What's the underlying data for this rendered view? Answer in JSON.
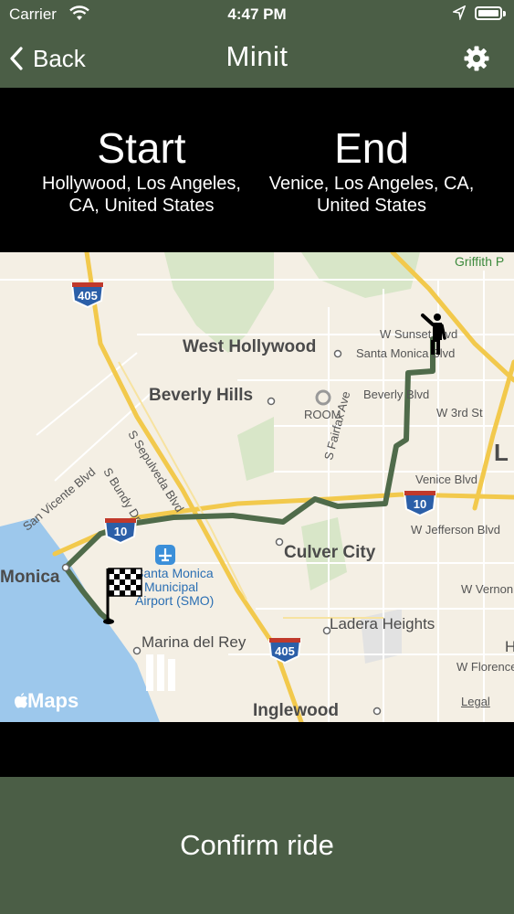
{
  "status_bar": {
    "carrier": "Carrier",
    "time": "4:47 PM"
  },
  "nav": {
    "back_label": "Back",
    "title": "Minit"
  },
  "trip": {
    "start_heading": "Start",
    "start_place_line1": "Hollywood, Los Angeles,",
    "start_place_line2": "CA, United States",
    "end_heading": "End",
    "end_place_line1": "Venice, Los Angeles, CA,",
    "end_place_line2": "United States"
  },
  "map": {
    "labels": {
      "griffith": "Griffith P",
      "w_sunset": "W Sunset Blvd",
      "west_hollywood": "West Hollywood",
      "santa_monica_blvd": "Santa Monica Blvd",
      "beverly_hills": "Beverly Hills",
      "room": "ROOM",
      "beverly_blvd": "Beverly Blvd",
      "w_3rd": "W 3rd St",
      "s_fairfax": "S Fairfax Ave",
      "venice_blvd": "Venice Blvd",
      "s_sepulveda": "S Sepulveda Blvd",
      "s_bundy": "S Bundy Dr",
      "san_vicente": "San Vicente Blvd",
      "w_jefferson": "W Jefferson Blvd",
      "culver_city": "Culver City",
      "monica": "Monica",
      "smo_line1": "Santa Monica",
      "smo_line2": "Municipal",
      "smo_line3": "Airport (SMO)",
      "w_vernon": "W Vernon A",
      "ladera": "Ladera Heights",
      "marina": "Marina del Rey",
      "w_florence": "W Florence",
      "inglewood": "Inglewood",
      "l_letter": "L",
      "h_letter": "H",
      "legal": "Legal",
      "apple_maps": "Maps"
    },
    "shields": {
      "i405_top": "405",
      "i10": "10",
      "i405_bottom": "405",
      "i10_west": "10"
    },
    "route_color": "#4f6b4a",
    "water_color": "#9dc8ec"
  },
  "confirm_label": "Confirm ride",
  "colors": {
    "bar": "#4b5e46",
    "background": "#000000"
  }
}
